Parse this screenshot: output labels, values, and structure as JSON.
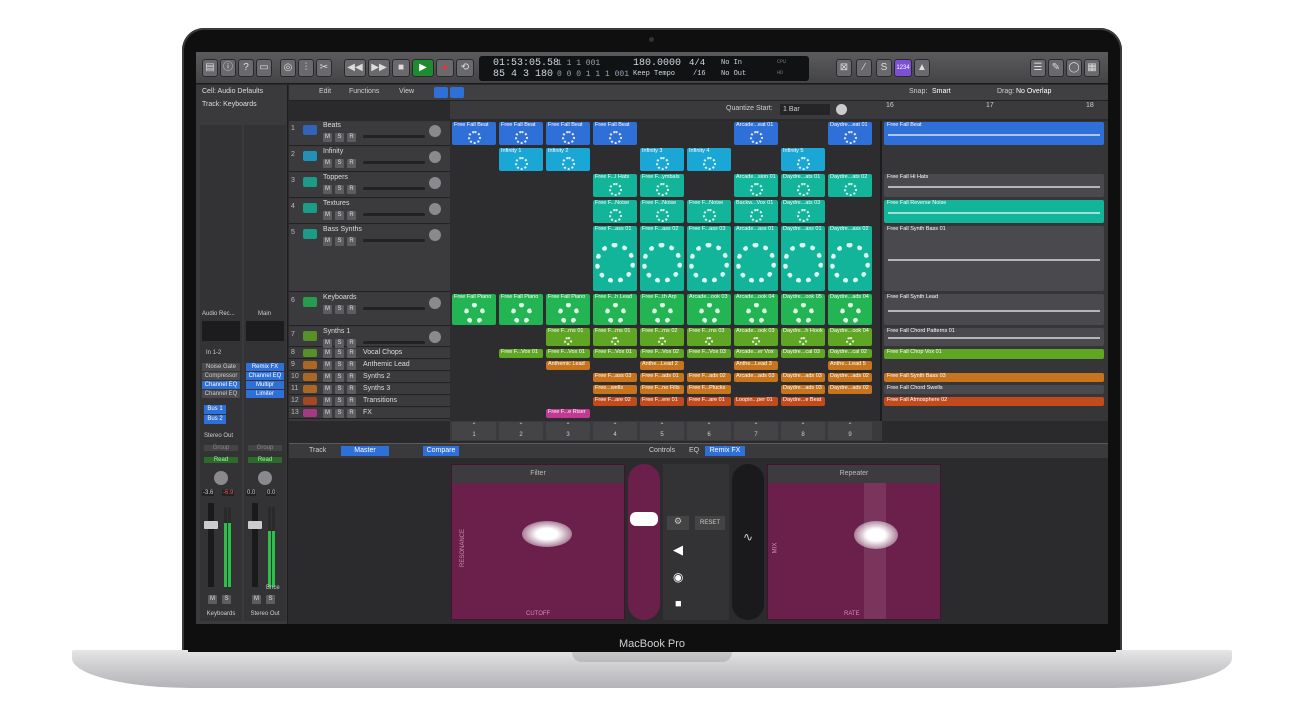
{
  "device": {
    "label": "MacBook Pro"
  },
  "transport": {
    "position": "01:53:05.58",
    "bars": "1 1 1 001",
    "tempo": "180.0000",
    "timesig": "4/4",
    "midi_in": "No In",
    "position2": "85 4 3 180",
    "bars2": "0 0 0 1 1 1 001",
    "tempo_mode": "Keep Tempo",
    "division": "/16",
    "midi_out": "No Out",
    "cpu_label": "CPU",
    "hd_label": "HD",
    "key_badge": "1234"
  },
  "menu": {
    "edit": "Edit",
    "functions": "Functions",
    "view": "View",
    "snap_label": "Snap:",
    "snap_value": "Smart",
    "drag_label": "Drag:",
    "drag_value": "No Overlap",
    "quantize_label": "Quantize Start:",
    "quantize_value": "1 Bar"
  },
  "inspector": {
    "cell": "Cell: Audio Defaults",
    "track": "Track: Keyboards",
    "strip1": {
      "label": "Audio Rec...",
      "input": "In 1-2",
      "plugins": [
        "Noise Gate",
        "Compressor",
        "Channel EQ",
        "Channel EQ"
      ],
      "sends": [
        "Bus 1",
        "Bus 2"
      ],
      "output": "Stereo Out",
      "group": "Group",
      "read": "Read",
      "pan_l": "-3.6",
      "pan_r": "-6.9",
      "name": "Keyboards"
    },
    "strip2": {
      "label": "Main",
      "plugins": [
        "Remix FX",
        "Channel EQ",
        "Multipr",
        "Limiter"
      ],
      "group": "Group",
      "read": "Read",
      "pan_l": "0.0",
      "pan_r": "0.0",
      "bnce": "Bnce",
      "name": "Stereo Out"
    }
  },
  "tracks": [
    {
      "n": "1",
      "name": "Beats"
    },
    {
      "n": "2",
      "name": "Infinity"
    },
    {
      "n": "3",
      "name": "Toppers"
    },
    {
      "n": "4",
      "name": "Textures"
    },
    {
      "n": "5",
      "name": "Bass Synths"
    },
    {
      "n": "6",
      "name": "Keyboards"
    },
    {
      "n": "7",
      "name": "Synths 1"
    },
    {
      "n": "8",
      "name": "Vocal Chops"
    },
    {
      "n": "9",
      "name": "Anthemic Lead"
    },
    {
      "n": "10",
      "name": "Synths 2"
    },
    {
      "n": "11",
      "name": "Synths 3"
    },
    {
      "n": "12",
      "name": "Transitions"
    },
    {
      "n": "13",
      "name": "FX"
    }
  ],
  "cells": [
    [
      "Free Fall Beat",
      "Free Fall Beat",
      "Free Fall Beat",
      "Free Fall Beat",
      "",
      "",
      "Arcade...eat 01",
      "",
      "Daydre...eat 01"
    ],
    [
      "",
      "Infinity 1",
      "Infinity 2",
      "",
      "Infinity 3",
      "Infinity 4",
      "",
      "Infinity 5",
      ""
    ],
    [
      "",
      "",
      "",
      "Free F...l Hats",
      "Free F...ymbals",
      "",
      "Arcade...sion 01",
      "Daydre...ats 01",
      "Daydre...ats 02"
    ],
    [
      "",
      "",
      "",
      "Free F...Noise",
      "Free F...Noise",
      "Free F...Noise",
      "Backw...Vox 01",
      "Daydre...ats 03",
      ""
    ],
    [
      "",
      "",
      "",
      "Free F...ass 01",
      "Free F...ass 02",
      "Free F...ass 03",
      "Arcade...ass 01",
      "Daydre...ass 01",
      "Daydre...ass 02"
    ],
    [
      "Free Fall Piano",
      "Free Fall Piano",
      "Free Fall Piano",
      "Free F...h Lead",
      "Free F...th Arp",
      "Arcade...ook 03",
      "Arcade...ook 04",
      "Daydre...ook 05",
      "Daydre...ads 04"
    ],
    [
      "",
      "",
      "Free F...rns 01",
      "Free F...rns 01",
      "Free F...rns 02",
      "Free F...rns 03",
      "Arcade...ook 03",
      "Daydre...h Hook",
      "Daydre...ook 04"
    ],
    [
      "",
      "Free F...Vox 01",
      "Free F...Vox 01",
      "Free F...Vox 01",
      "Free F...Vox 02",
      "Free F...Vox 03",
      "Arcade...er Vox",
      "Daydre...cal 03",
      "Daydre...cal 02"
    ],
    [
      "",
      "",
      "Anthemic Lead",
      "",
      "Anthe...Lead 2",
      "",
      "Anthe...Lead 3",
      "",
      "Anthe...Lead 5"
    ],
    [
      "",
      "",
      "",
      "Free F...ass 03",
      "Free F...ads 01",
      "Free F...ads 02",
      "Arcade...ads 03",
      "Daydre...ads 03",
      "Daydre...ads 02"
    ],
    [
      "",
      "",
      "",
      "Free...wells",
      "Free F...ne Fills",
      "Free F...Plucks",
      "",
      "Daydre...ads 03",
      "Daydre...ads 02"
    ],
    [
      "",
      "",
      "",
      "Free F...are 02",
      "Free F...ere 01",
      "Free F...are 01",
      "Loopin...per 01",
      "Daydre...e Beat",
      ""
    ],
    [
      "",
      "",
      "Free F...e Riser",
      "",
      "",
      "",
      "",
      "",
      ""
    ]
  ],
  "scenes": [
    "1",
    "2",
    "3",
    "4",
    "5",
    "6",
    "7",
    "8",
    "9"
  ],
  "regions": [
    "Free Fall Beat",
    "Free Fall Hi Hats",
    "Free Fall Reverse Noise",
    "Free Fall Synth Bass 01",
    "Free Fall Synth Lead",
    "Free Fall Chord Patterns 01",
    "Free Fall Chop Vox 01",
    "Free Fall Synth Bass 03",
    "Free Fall Chord Swells",
    "Free Fall Atmosphere 02"
  ],
  "ruler": [
    "16",
    "17",
    "18"
  ],
  "fx": {
    "tabs": {
      "track": "Track",
      "master": "Master",
      "compare": "Compare",
      "controls": "Controls",
      "eq": "EQ",
      "remix": "Remix FX"
    },
    "pad_left": {
      "title": "Filter",
      "x": "CUTOFF",
      "y": "RESONANCE"
    },
    "pad_right": {
      "title": "Repeater",
      "x": "RATE",
      "y": "MIX"
    },
    "reset": "RESET"
  },
  "colors": {
    "blue": "#2f6fd8",
    "cyan": "#1aa7d6",
    "teal": "#13b59a",
    "green": "#23b553",
    "lime": "#5fa624",
    "orange": "#c7741e",
    "magenta": "#c03a94",
    "red": "#c24b1e",
    "pad": "#6b1f4b"
  }
}
